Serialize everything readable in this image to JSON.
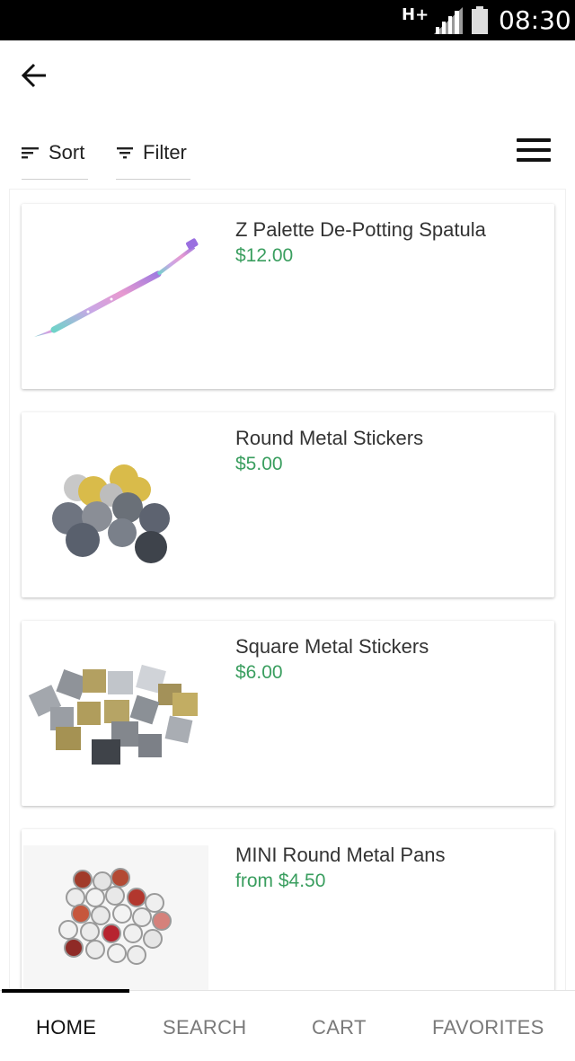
{
  "status_bar": {
    "network": "H+",
    "time": "08:30",
    "icons": [
      "signal-icon",
      "battery-icon"
    ]
  },
  "header": {
    "back_icon": "arrow-left-icon",
    "menu_icon": "hamburger-menu-icon"
  },
  "toolbar": {
    "sort_label": "Sort",
    "filter_label": "Filter"
  },
  "products": [
    {
      "title": "Z Palette De-Potting Spatula",
      "price": "$12.00",
      "image": "spatula"
    },
    {
      "title": "Round Metal Stickers",
      "price": "$5.00",
      "image": "round-stickers"
    },
    {
      "title": "Square Metal Stickers",
      "price": "$6.00",
      "image": "square-stickers"
    },
    {
      "title": "MINI Round Metal Pans",
      "price": "from $4.50",
      "image": "metal-pans"
    }
  ],
  "bottom_nav": {
    "items": [
      {
        "label": "HOME",
        "active": true
      },
      {
        "label": "SEARCH",
        "active": false
      },
      {
        "label": "CART",
        "active": false
      },
      {
        "label": "FAVORITES",
        "active": false
      }
    ]
  },
  "colors": {
    "price": "#3a9e5f",
    "status_bar": "#000000",
    "active_tab": "#111111",
    "inactive_tab": "#7a7a7a"
  }
}
